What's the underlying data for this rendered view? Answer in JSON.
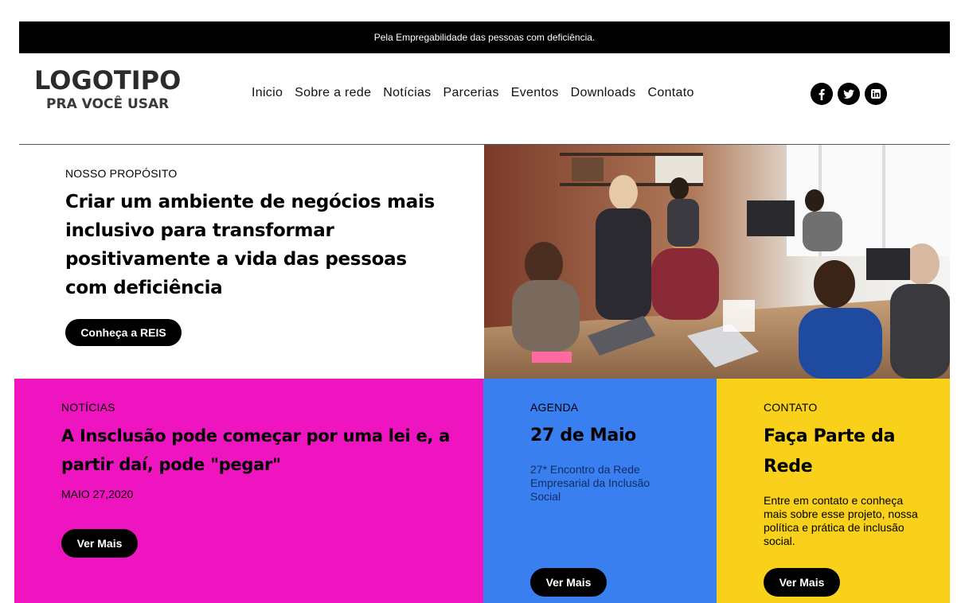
{
  "topbar": {
    "text": "Pela Empregabilidade das pessoas com deficiência."
  },
  "logo": {
    "line1": "LOGOTIPO",
    "line2": "PRA VOCÊ USAR"
  },
  "nav": {
    "items": [
      "Inicio",
      "Sobre a rede",
      "Notícias",
      "Parcerias",
      "Eventos",
      "Downloads",
      "Contato"
    ]
  },
  "social": {
    "icons": [
      "facebook-icon",
      "twitter-icon",
      "linkedin-icon"
    ]
  },
  "hero": {
    "eyebrow": "NOSSO PROPÓSITO",
    "title": "Criar um ambiente de negócios mais inclusivo para transformar positivamente a vida das pessoas com deficiência",
    "button": "Conheça a REIS"
  },
  "news": {
    "eyebrow": "NOTÍCIAS",
    "title": "A Insclusão pode começar por uma lei e, a partir daí, pode \"pegar\"",
    "date": "MAIO 27,2020",
    "button": "Ver Mais",
    "bg": "#ee14bf"
  },
  "agenda": {
    "eyebrow": "AGENDA",
    "title": "27 de Maio",
    "text": "27* Encontro da Rede Empresarial da Inclusão Social",
    "button": "Ver Mais",
    "bg": "#3a7ff0"
  },
  "contato": {
    "eyebrow": "CONTATO",
    "title": "Faça Parte da Rede",
    "text": "Entre em contato e conheça mais sobre esse projeto, nossa política e prática de inclusão social.",
    "button": "Ver Mais",
    "bg": "#f9d01a"
  }
}
